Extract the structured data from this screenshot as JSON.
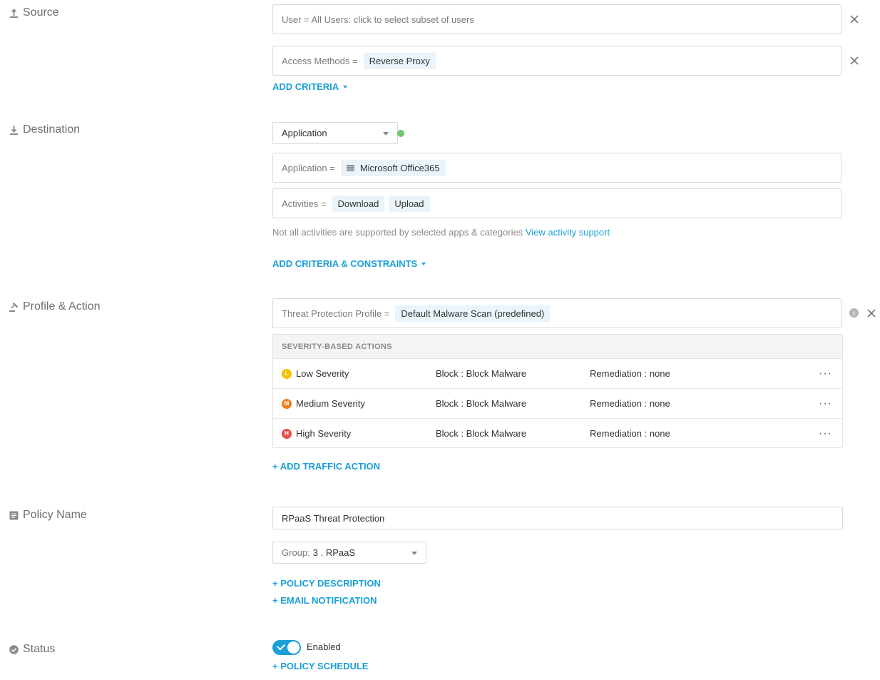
{
  "sections": {
    "source": "Source",
    "destination": "Destination",
    "profile_action": "Profile & Action",
    "policy_name": "Policy Name",
    "status": "Status"
  },
  "source": {
    "user_field": "User = All Users: click to select subset of users",
    "access_label": "Access Methods =",
    "access_value": "Reverse Proxy",
    "add_criteria": "ADD CRITERIA"
  },
  "destination": {
    "type_select": "Application",
    "app_label": "Application =",
    "app_value": "Microsoft Office365",
    "activities_label": "Activities =",
    "activities": [
      "Download",
      "Upload"
    ],
    "hint_text": "Not all activities are supported by selected apps & categories",
    "hint_link": "View activity support",
    "add_criteria_constraints": "ADD CRITERIA & CONSTRAINTS"
  },
  "profile": {
    "threat_label": "Threat Protection Profile =",
    "threat_value": "Default Malware Scan (predefined)",
    "table_header": "SEVERITY-BASED ACTIONS",
    "rows": [
      {
        "badge": "L",
        "color": "#f2c200",
        "name": "Low Severity",
        "action": "Block : Block Malware",
        "remediation": "Remediation : none"
      },
      {
        "badge": "M",
        "color": "#f07d1c",
        "name": "Medium Severity",
        "action": "Block : Block Malware",
        "remediation": "Remediation : none"
      },
      {
        "badge": "H",
        "color": "#e8504a",
        "name": "High Severity",
        "action": "Block : Block Malware",
        "remediation": "Remediation : none"
      }
    ],
    "add_traffic_action": "+ ADD TRAFFIC ACTION"
  },
  "policy": {
    "name_value": "RPaaS Threat Protection",
    "group_label": "Group:",
    "group_value": "3 . RPaaS",
    "add_description": "+ POLICY DESCRIPTION",
    "add_email": "+ EMAIL NOTIFICATION"
  },
  "status": {
    "toggle_label": "Enabled",
    "add_schedule": "+ POLICY SCHEDULE"
  },
  "colors": {
    "accent": "#1a9fd6",
    "chip_bg": "#eaf4fa",
    "green_dot": "#6cc66c"
  }
}
